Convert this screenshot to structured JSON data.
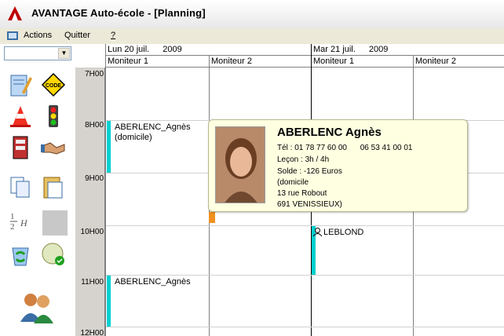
{
  "window": {
    "title": "AVANTAGE Auto-école - [Planning]"
  },
  "menu": {
    "actions": "Actions",
    "quit": "Quitter",
    "help": "?"
  },
  "header": {
    "day1": {
      "label": "Lun 20 juil.",
      "year": "2009"
    },
    "day2": {
      "label": "Mar 21 juil.",
      "year": "2009"
    },
    "monitors": [
      "Moniteur 1",
      "Moniteur 2",
      "Moniteur 1",
      "Moniteur 2"
    ]
  },
  "hours": [
    "7H00",
    "8H00",
    "9H00",
    "10H00",
    "11H00",
    "12H00"
  ],
  "lessons": {
    "l1": {
      "name": "ABERLENC_Agnès",
      "note": "(domicile)"
    },
    "l2": {
      "name": "LEBLOND"
    },
    "l3": {
      "name": "ABERLENC_Agnès"
    }
  },
  "tooltip": {
    "name": "ABERLENC Agnès",
    "phone": "Tél : 01 78 77 60 00",
    "phone2": "06 53 41 00 01",
    "lesson": "Leçon : 3h / 4h",
    "balance": "Solde : -126 Euros",
    "location": "(domicile",
    "address": "13 rue Robout",
    "city": "691 VENISSIEUX)"
  },
  "icons": {
    "tools": [
      "notepad-icon",
      "code-icon",
      "traffic-cone-icon",
      "traffic-light-icon",
      "register-icon",
      "handshake-icon",
      "copy-icon",
      "paste-icon",
      "half-hour-icon",
      "blank-icon",
      "recycle-icon",
      "clock-money-icon",
      "users-icon"
    ]
  },
  "colors": {
    "lesson": "#00d0d0",
    "tooltip_bg": "#ffffe1",
    "marker": "#f0901e"
  }
}
